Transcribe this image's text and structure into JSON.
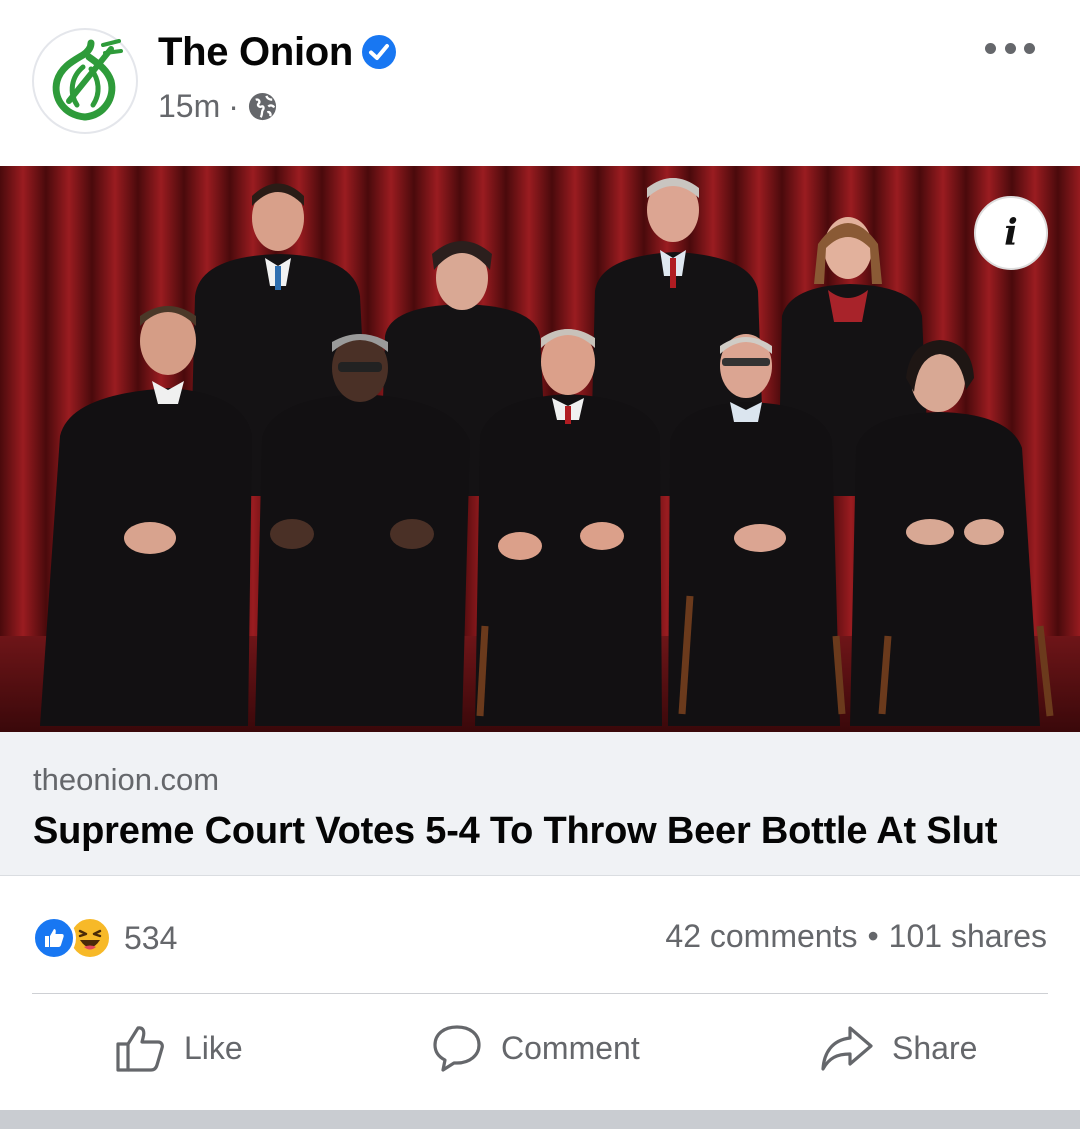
{
  "post": {
    "page_name": "The Onion",
    "time": "15m",
    "separator": "·",
    "privacy_icon": "globe-icon",
    "verified_icon": "verified-badge-icon",
    "avatar_icon": "onion-logo-icon",
    "more_icon": "more-options-icon"
  },
  "link": {
    "domain": "theonion.com",
    "title": "Supreme Court Votes 5-4 To Throw Beer Bottle At Slut",
    "info_label": "i"
  },
  "stats": {
    "reaction_icons": [
      "like-reaction-icon",
      "haha-reaction-icon"
    ],
    "reaction_count": "534",
    "comments": "42 comments",
    "dot": "•",
    "shares": "101 shares"
  },
  "actions": {
    "like": "Like",
    "comment": "Comment",
    "share": "Share"
  },
  "colors": {
    "accent": "#1877f2",
    "onion_green": "#2e9b3a",
    "muted_text": "#65676b",
    "link_bg": "#f0f2f5",
    "curtain": "#7a1418"
  }
}
